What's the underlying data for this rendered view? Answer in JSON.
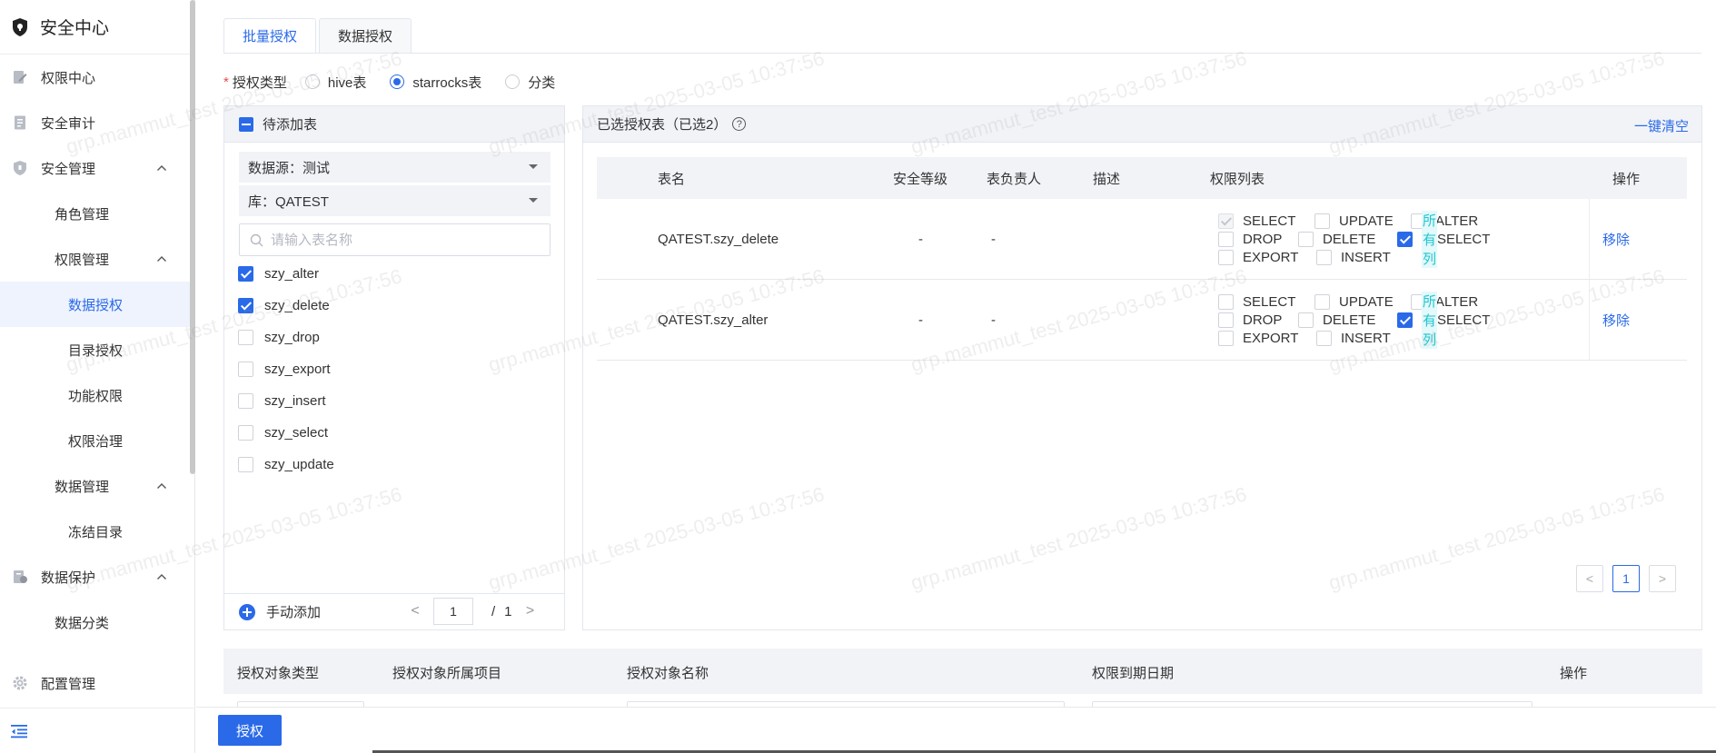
{
  "sidebar": {
    "title": "安全中心",
    "items": [
      {
        "label": "权限中心"
      },
      {
        "label": "安全审计"
      },
      {
        "label": "安全管理"
      },
      {
        "label": "角色管理"
      },
      {
        "label": "权限管理"
      },
      {
        "label": "数据授权"
      },
      {
        "label": "目录授权"
      },
      {
        "label": "功能权限"
      },
      {
        "label": "权限治理"
      },
      {
        "label": "数据管理"
      },
      {
        "label": "冻结目录"
      },
      {
        "label": "数据保护"
      },
      {
        "label": "数据分类"
      },
      {
        "label": "配置管理"
      }
    ]
  },
  "tabs": [
    {
      "label": "批量授权"
    },
    {
      "label": "数据授权"
    }
  ],
  "auth_type": {
    "required_mark": "*",
    "label": "授权类型",
    "options": [
      {
        "label": "hive表",
        "checked": false
      },
      {
        "label": "starrocks表",
        "checked": true
      },
      {
        "label": "分类",
        "checked": false
      }
    ]
  },
  "left_panel": {
    "header": "待添加表",
    "datasource": "数据源：测试",
    "database": "库：QATEST",
    "search_placeholder": "请输入表名称",
    "tables": [
      {
        "name": "szy_alter",
        "checked": true
      },
      {
        "name": "szy_delete",
        "checked": true
      },
      {
        "name": "szy_drop",
        "checked": false
      },
      {
        "name": "szy_export",
        "checked": false
      },
      {
        "name": "szy_insert",
        "checked": false
      },
      {
        "name": "szy_select",
        "checked": false
      },
      {
        "name": "szy_update",
        "checked": false
      }
    ],
    "manual_add": "手动添加",
    "pager": {
      "prev": "<",
      "current": "1",
      "slash": "/",
      "total": "1",
      "next": ">"
    }
  },
  "right_panel": {
    "header": "已选授权表（已选2）",
    "help": "?",
    "clear_all": "一键清空",
    "columns": {
      "name": "表名",
      "level": "安全等级",
      "owner": "表负责人",
      "desc": "描述",
      "perms": "权限列表",
      "op": "操作"
    },
    "rows": [
      {
        "name": "QATEST.szy_delete",
        "level": "-",
        "owner": "-",
        "remove": "移除",
        "perms": {
          "select": "SELECT",
          "update": "UPDATE",
          "alter": "ALTER",
          "drop": "DROP",
          "delete": "DELETE",
          "allcol": "所有列",
          "select2": "SELECT",
          "export": "EXPORT",
          "insert": "INSERT"
        }
      },
      {
        "name": "QATEST.szy_alter",
        "level": "-",
        "owner": "-",
        "remove": "移除",
        "perms": {
          "select": "SELECT",
          "update": "UPDATE",
          "alter": "ALTER",
          "drop": "DROP",
          "delete": "DELETE",
          "allcol": "所有列",
          "select2": "SELECT",
          "export": "EXPORT",
          "insert": "INSERT"
        }
      }
    ],
    "pager": {
      "prev": "<",
      "current": "1",
      "next": ">"
    }
  },
  "bottom_table": {
    "columns": {
      "type": "授权对象类型",
      "project": "授权对象所属项目",
      "name": "授权对象名称",
      "expire": "权限到期日期",
      "op": "操作"
    }
  },
  "footer": {
    "grant": "授权"
  },
  "watermark": "grp.mammut_test 2025-03-05 10:37:56",
  "colors": {
    "primary": "#2a6ae8",
    "allcol_tag": "#22c4cf",
    "header_bg": "#f1f3f7"
  }
}
